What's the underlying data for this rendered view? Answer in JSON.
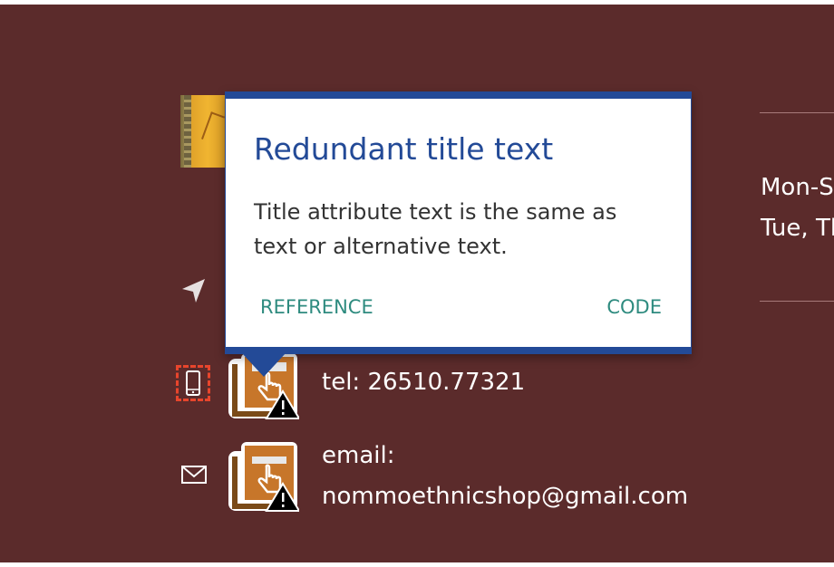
{
  "hours": {
    "line1": "Mon-S",
    "line2": "Tue, Th"
  },
  "contact": {
    "phone": "tel: 26510.77321",
    "email_label": "email:",
    "email_value": "nommoethnicshop@gmail.com"
  },
  "tooltip": {
    "title": "Redundant title text",
    "body": "Title attribute text is the same as text or alternative text.",
    "reference_link": "REFERENCE",
    "code_link": "CODE"
  },
  "icons": {
    "navigation": "location-arrow-icon",
    "phone": "mobile-phone-icon",
    "mail": "envelope-icon",
    "warning_badge": "hand-pointer-warning-icon"
  },
  "colors": {
    "background": "#5b2b2b",
    "tooltip_accent": "#234a97",
    "link": "#2e8b7f",
    "error_outline": "#e8452c",
    "badge_orange": "#c7762a"
  }
}
